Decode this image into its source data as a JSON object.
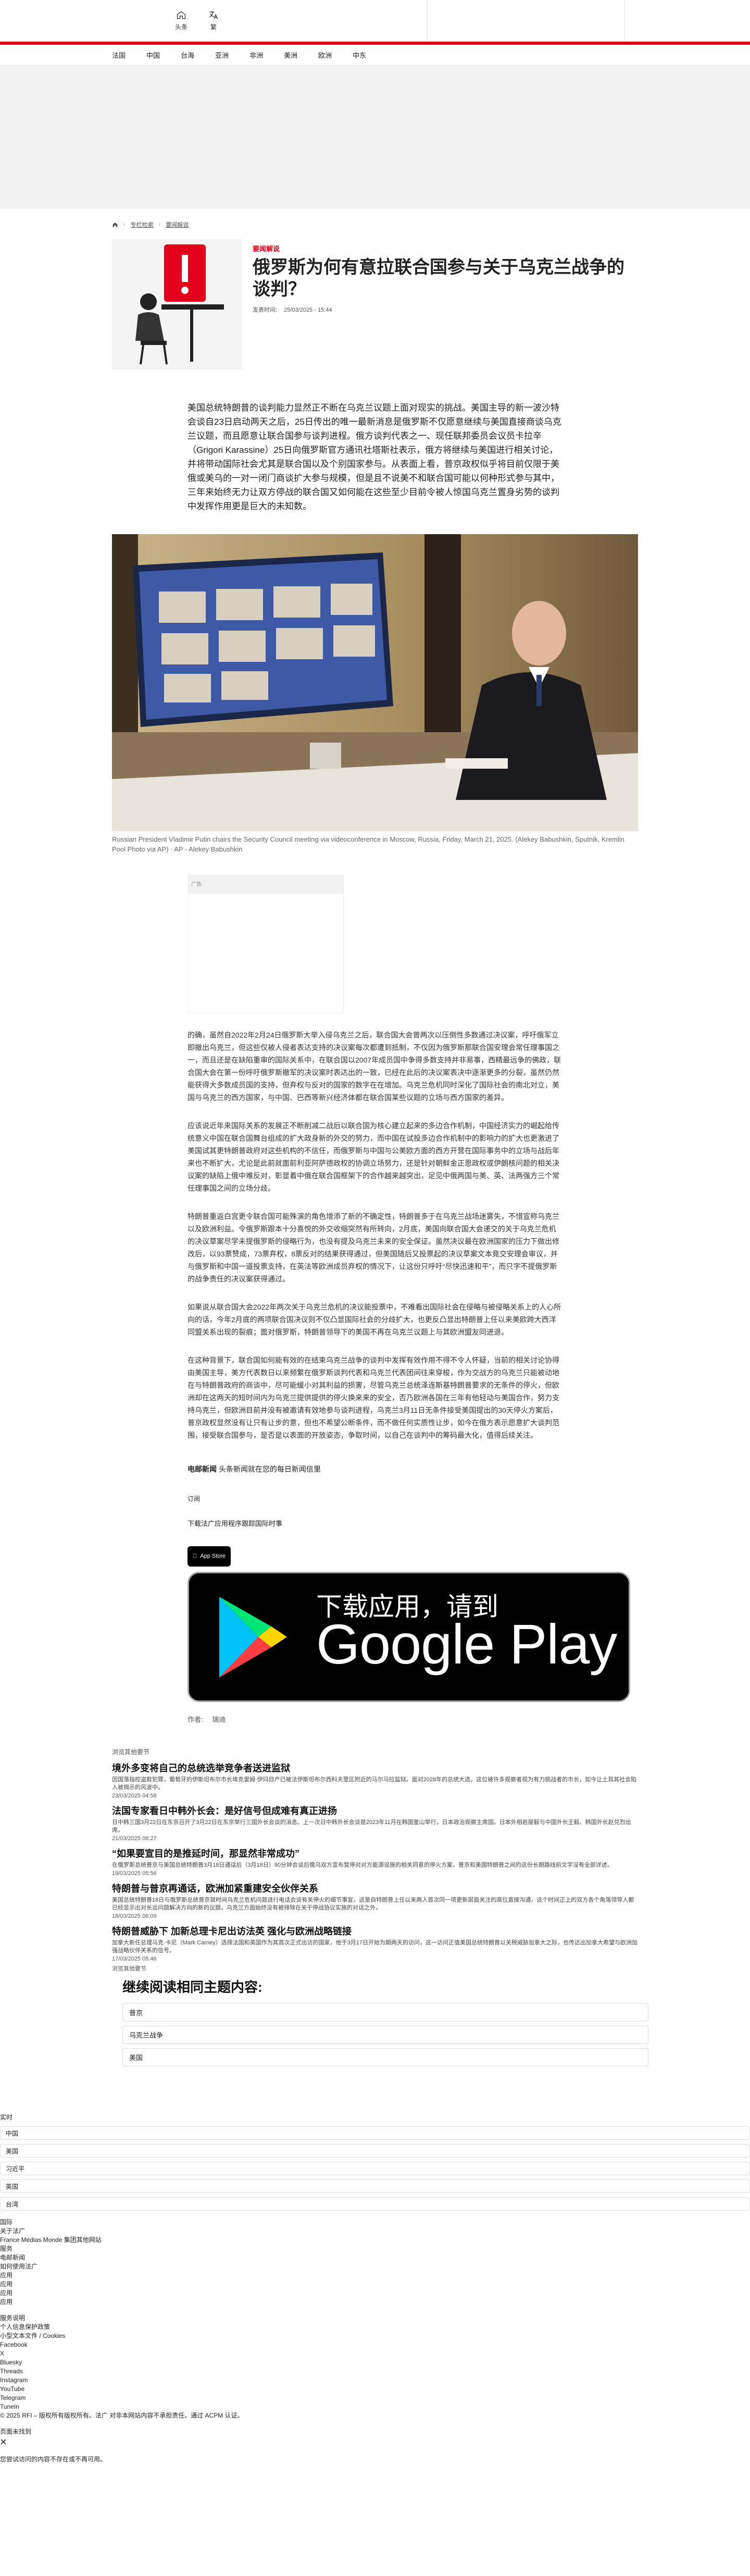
{
  "topbar": {
    "home_label": "头条",
    "translate_label": "繁"
  },
  "nav": {
    "items": [
      "法国",
      "中国",
      "台海",
      "亚洲",
      "非洲",
      "美洲",
      "欧洲",
      "中东"
    ]
  },
  "breadcrumb": {
    "items": [
      "专栏检索",
      "要闻解说"
    ]
  },
  "article": {
    "kicker": "要闻解说",
    "title": "俄罗斯为何有意拉联合国参与关于乌克兰战争的谈判？",
    "date_label": "发表时间:",
    "date_value": "25/03/2025 - 15:44",
    "lead": "美国总统特朗普的谈判能力显然正不断在乌克兰议题上面对现实的挑战。美国主导的新一波沙特会谈自23日启动两天之后，25日传出的唯一最新消息是俄罗斯不仅愿意继续与美国直接商谈乌克兰议题，而且愿意让联合国参与谈判进程。俄方谈判代表之一、现任联邦委员会议员卡拉辛（Grigori Karassine）25日向俄罗斯官方通讯社塔斯社表示，俄方将继续与美国进行相关讨论，并将带动国际社会尤其是联合国以及个别国家参与。从表面上看，普京政权似乎将目前仅限于美俄或美乌的一对一闭门商谈扩大参与规模，但是且不说美不和联合国可能以何种形式参与其中，三年来始终无力让双方停战的联合国又如何能在这些至少目前令被人惊国乌克兰置身劣势的谈判中发挥作用更是巨大的未知数。",
    "photo_caption": "Russian President Vladimir Putin chairs the Security Council meeting via videoconference in Moscow, Russia, Friday, March 21, 2025. (Alekey Babushkin, Sputnik, Kremlin Pool Photo via AP) · AP - Alekey Babushkin",
    "ad_label": "广告",
    "paragraphs": [
      "的确，虽然自2022年2月24日俄罗斯大举入侵乌克兰之后，联合国大会曾两次以压倒性多数通过决议案，呼吁俄军立即撤出乌克兰，但这些仅被人侵者表达支持的决议案每次都遭到抵制，不仅因为俄罗斯那联合国安理会常任理事国之一，而且还是在缺陷重审的国际关系中，在联合国以2007年成员国中争得多数支持并非易事，西精最远争的佛政，联合国大会在第一份呼吁俄罗斯撤军的决议案时表达出的一致，已经在此后的决议案表决中逐渐更多的分裂，虽然仍然能获得大多数成员国的支持，但弃权与反对的国家的数字在在增加。乌克兰危机同时深化了国际社会的南北对立，美国与乌克兰的西方国家，与中国、巴西等新兴经济体都在联合国某些议题的立场与西方国家的差异。",
      "应该说近年来国际关系的发展正不断削减二战后以联合国为核心建立起来的多边合作机制，中国经济实力的崛起给传统意义中国在联合国舞台组成的扩大政身新的外交的努力，而中国在试投多边合作机制中的影响力的扩大也更激进了美国试其更特朗普政府对这些机构的不信任，而俄罗斯与中国与公美欧方面的西方开营在国际事务中的立场与战后年来也不断扩大，尤论是此前就面前利亚阿萨德政权的协调立场努力，还是针对朝鲜金正恩政权或伊朗核问题的相关决议案的缺陷上俄中难反对，彰显着中俄在联合国框架下的合作越来越突出，足见中俄两国与美、英、法两强方三个常任理事国之间的立场分歧。",
      "特朗普重返白宫更令联合国可能殊演的角色增添了新的不确定性，特朗普多于在乌克兰战场迷雾失，不惜宣称乌克兰以及欧洲利益。令俄罗斯跟本十分喜悦的外交收缩突然有所转向，2月底，美国向联合国大会递交的关于乌克兰危机的决议草案尽学未提俄罗斯的侵略行为，也没有提及乌克兰未来的安全保证。虽然决议最在欧洲国家的压力下做出修改后，以93票赞成，73票弃权，8票反对的结果获得通过，但美国随后又投票起的决议草案文本竟交安理会审议，并与俄罗斯和中国一道投票支持，在英法等欧洲成员弃权的情况下，让这份只呼吁“尽快迅速和平”，而只字不提俄罗斯的战争责任的决议案获得通过。",
      "如果说从联合国大会2022年两次关于乌克兰危机的决议能投票中，不难看出国际社会在侵略与被侵略关系上的人心所向的话，今年2月底的两项联合国决议则不仅凸显国际社会的分歧扩大，也更反凸显出特朗普上任以来美欧跨大西洋同盟关系出现的裂痕；面对俄罗斯，特朗普领导下的美国不再在乌克兰议题上与其欧洲盟友同进退。",
      "在这种背景下，联合国如何能有效的在结束乌克兰战争的谈判中发挥有效作用不得不令人怀疑，当前的相关讨论协得由美国主导，美方代表数日以来频繁在俄罗斯谈判代表和乌克兰代表团间往来穿梭，作为交战方的乌克兰只能被动地在与特朗普政府的商谈中，尽可能缓小对其利益的损害，尽管乌克兰总统泽连斯基特朗普要求的无条件的停火，但欧洲却在这两天的短时间内为乌克兰提供提供的停火换来来的安全，否乃欧洲各国在三年有他轻动与美国合作，努力支持乌克兰，但欧洲目前并没有被邀请有效地参与谈判进程，乌克兰3月11日无条件接受美国提出的30天停火方案后，普京政权显然没有让只有让步的意，但也不希望公断条件，而不做任何实质性让步，如今在俄方表示愿意扩大谈判范围，接受联合国参与，是否是以表面的开放姿态，争取时间，以自己在谈判中的筹码最大化，值得后续关注。"
    ],
    "newsletter_bold": "电邮新闻",
    "newsletter_text": "头条新闻就在您的每日新闻信里",
    "subscribe_label": "订阅",
    "download_text": "下载法广应用程序跟踪国际时事",
    "appstore_label": "App Store",
    "gplay_small": "下载应用，请到",
    "gplay_big": "Google Play",
    "author_label": "作者:",
    "author_value": "瑞迪"
  },
  "more_news": {
    "head": "浏览其他要节",
    "items": [
      {
        "title": "境外多变将自己的总统选举竞争者送进监狱",
        "summary": "因国落指控盗欺犯罪，葡萄牙的伊斯坦布尔市长埃克雷姆·伊玛目产已被法伊斯坦布尔西科夫里区附近的马尔马拉监狱。面对2028年的总统大选，这位被许多观察者视为有力挑战者的市长，如今让土耳其社会陷入被揭示的风波中。",
        "time": "23/03/2025 04:58"
      },
      {
        "title": "法国专家看日中韩外长会：是好信号但成难有真正进扬",
        "summary": "日中韩三国3月22日在东京召开了3月22日在东京举行三国外长会谈的消息。上一次日中韩外长会谈是2023年11月在韩国釜山举行，日本政治观察主席国。日本外相岩屋毅与中国外长王毅、韩国外长赵兑烈出席。",
        "time": "21/03/2025 08:27"
      },
      {
        "title": "“如果要宣目的是推延时间，那显然非常成功”",
        "summary": "在俄罗斯总统普京与美国总统特朗普3月18日通话后（3月18日）90分钟会谈后俄乌双方宣布暂停对对方能源设施的相关同意的停火方案，普京和美国特朗普之间的这份长期路线前文字沒有全部详述。",
        "time": "19/03/2025 05:56"
      },
      {
        "title": "特朗普与普京再通话，欧洲加紧重建安全伙伴关系",
        "summary": "美国总统特朗普18日与俄罗斯总统普京就时间乌克兰危机问题进行电话会谈有关停火的细节事宜，这是自特朗普上任以来两人首次同一项更新层面关注的高位直接沟通，这个时间正上的双方各个角落领导人都已经显示出对长远问题解决方向的新的议题，乌克兰方面始终没有被排除在关于停战协议实施的对话之外。",
        "time": "18/03/2025 06:09"
      },
      {
        "title": "特朗普威胁下 加新总理卡尼出访法英 强化与欧洲战略链接",
        "summary": "加拿大新任总理马克·卡尼（Mark Carney）选择法国和英国作为其首次正式出访的国家，他于3月17日开始为期两天的访问，这一访问正值美国总统特朗普以关税威胁加拿大之际，也传达出加拿大希望与欧洲加强战略伙伴关系的信号。",
        "time": "17/03/2025 05:46"
      }
    ],
    "tail": "浏览其他要节"
  },
  "related": {
    "heading": "继续阅读相同主题内容:",
    "tags": [
      "普京",
      "乌克兰战争",
      "美国"
    ]
  },
  "footer": {
    "label_top": "实时",
    "list_rows": [
      "中国",
      "美国",
      "习近平",
      "英国",
      "台湾"
    ],
    "lines_a": [
      "国际",
      "关于法广",
      "France Médias Monde 集团其他网站",
      "服务",
      "电邮新闻",
      "如何使用法广",
      "应用",
      "应用",
      "应用",
      "应用"
    ],
    "lines_b": [
      "服务说明",
      "个人信息保护政策",
      "小型文本文件 / Cookies",
      "Facebook",
      "X",
      "Bluesky",
      "Threads",
      "Instagram",
      "YouTube",
      "Telegram",
      "TuneIn",
      "© 2025 RFI – 版权所有版权所有。法广 对非本网站内容不承担责任。通过 ACPM 认证。"
    ],
    "search_label": "页面未找到",
    "close_icon": "×",
    "final": "您尝试访问的内容不存在或不再可用。"
  },
  "colors": {
    "accent": "#e2001a",
    "dark": "#111111"
  }
}
